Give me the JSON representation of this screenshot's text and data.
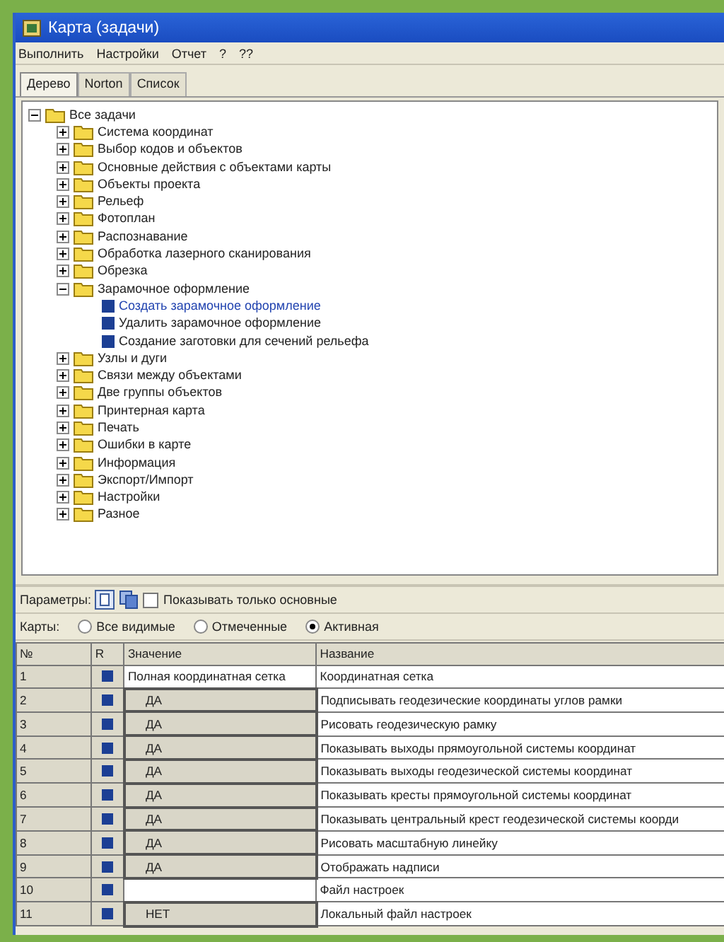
{
  "window": {
    "title": "Карта (задачи)"
  },
  "menu": [
    "Выполнить",
    "Настройки",
    "Отчет",
    "?",
    "??"
  ],
  "tabs": [
    {
      "label": "Дерево",
      "selected": true
    },
    {
      "label": "Norton",
      "selected": false
    },
    {
      "label": "Список",
      "selected": false
    }
  ],
  "tree": {
    "label": "Все задачи",
    "kind": "folder",
    "expanded": true,
    "children": [
      {
        "label": "Система координат",
        "kind": "folder",
        "expanded": false
      },
      {
        "label": "Выбор кодов и объектов",
        "kind": "folder",
        "expanded": false
      },
      {
        "label": "Основные действия с объектами карты",
        "kind": "folder",
        "expanded": false
      },
      {
        "label": "Объекты проекта",
        "kind": "folder",
        "expanded": false
      },
      {
        "label": "Рельеф",
        "kind": "folder",
        "expanded": false
      },
      {
        "label": "Фотоплан",
        "kind": "folder",
        "expanded": false
      },
      {
        "label": "Распознавание",
        "kind": "folder",
        "expanded": false
      },
      {
        "label": "Обработка лазерного сканирования",
        "kind": "folder",
        "expanded": false
      },
      {
        "label": "Обрезка",
        "kind": "folder",
        "expanded": false
      },
      {
        "label": "Зарамочное оформление",
        "kind": "folder",
        "expanded": true,
        "children": [
          {
            "label": "Создать зарамочное оформление",
            "kind": "task",
            "selected": true
          },
          {
            "label": "Удалить зарамочное оформление",
            "kind": "task",
            "selected": false
          },
          {
            "label": "Создание заготовки для сечений рельефа",
            "kind": "task",
            "selected": false
          }
        ]
      },
      {
        "label": "Узлы и дуги",
        "kind": "folder",
        "expanded": false
      },
      {
        "label": "Связи между объектами",
        "kind": "folder",
        "expanded": false
      },
      {
        "label": "Две группы объектов",
        "kind": "folder",
        "expanded": false
      },
      {
        "label": "Принтерная карта",
        "kind": "folder",
        "expanded": false
      },
      {
        "label": "Печать",
        "kind": "folder",
        "expanded": false
      },
      {
        "label": "Ошибки в карте",
        "kind": "folder",
        "expanded": false
      },
      {
        "label": "Информация",
        "kind": "folder",
        "expanded": false
      },
      {
        "label": "Экспорт/Импорт",
        "kind": "folder",
        "expanded": false
      },
      {
        "label": "Настройки",
        "kind": "folder",
        "expanded": false
      },
      {
        "label": "Разное",
        "kind": "folder",
        "expanded": false
      }
    ]
  },
  "parameters": {
    "label": "Параметры:",
    "checkbox": {
      "label": "Показывать только основные",
      "checked": false
    }
  },
  "maps": {
    "label": "Карты:",
    "options": [
      {
        "label": "Все видимые",
        "selected": false
      },
      {
        "label": "Отмеченные",
        "selected": false
      },
      {
        "label": "Активная",
        "selected": true
      }
    ]
  },
  "table": {
    "columns": [
      "№",
      "R",
      "Значение",
      "Название"
    ],
    "rows": [
      {
        "number": "1",
        "value": "Полная координатная сетка",
        "kind": "text",
        "name": "Координатная сетка"
      },
      {
        "number": "2",
        "value": "ДА",
        "kind": "combo",
        "name": "Подписывать геодезические координаты углов рамки"
      },
      {
        "number": "3",
        "value": "ДА",
        "kind": "combo",
        "name": "Рисовать геодезическую рамку"
      },
      {
        "number": "4",
        "value": "ДА",
        "kind": "combo",
        "name": "Показывать выходы прямоугольной системы координат"
      },
      {
        "number": "5",
        "value": "ДА",
        "kind": "combo",
        "name": "Показывать выходы геодезической системы координат"
      },
      {
        "number": "6",
        "value": "ДА",
        "kind": "combo",
        "name": "Показывать кресты прямоугольной системы координат"
      },
      {
        "number": "7",
        "value": "ДА",
        "kind": "combo",
        "name": "Показывать центральный крест геодезической системы коорди"
      },
      {
        "number": "8",
        "value": "ДА",
        "kind": "combo",
        "name": "Рисовать масштабную линейку"
      },
      {
        "number": "9",
        "value": "ДА",
        "kind": "combo",
        "name": "Отображать надписи"
      },
      {
        "number": "10",
        "kind": "text",
        "name": "Файл настроек"
      },
      {
        "number": "11",
        "value": "НЕТ",
        "kind": "combo",
        "name": "Локальный файл настроек"
      }
    ]
  }
}
